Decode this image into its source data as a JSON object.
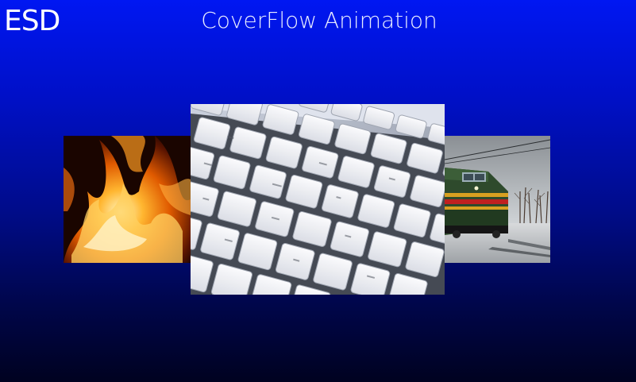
{
  "app": {
    "logo_text": "ESD",
    "title": "CoverFlow Animation"
  },
  "coverflow": {
    "items": [
      {
        "name": "fire-image",
        "subject": "flames"
      },
      {
        "name": "keyboard-image",
        "subject": "keyboard",
        "selected": true
      },
      {
        "name": "train-image",
        "subject": "train"
      }
    ]
  },
  "colors": {
    "background_top": "#0017f2",
    "background_bottom": "#000220",
    "text": "#ffffff"
  }
}
